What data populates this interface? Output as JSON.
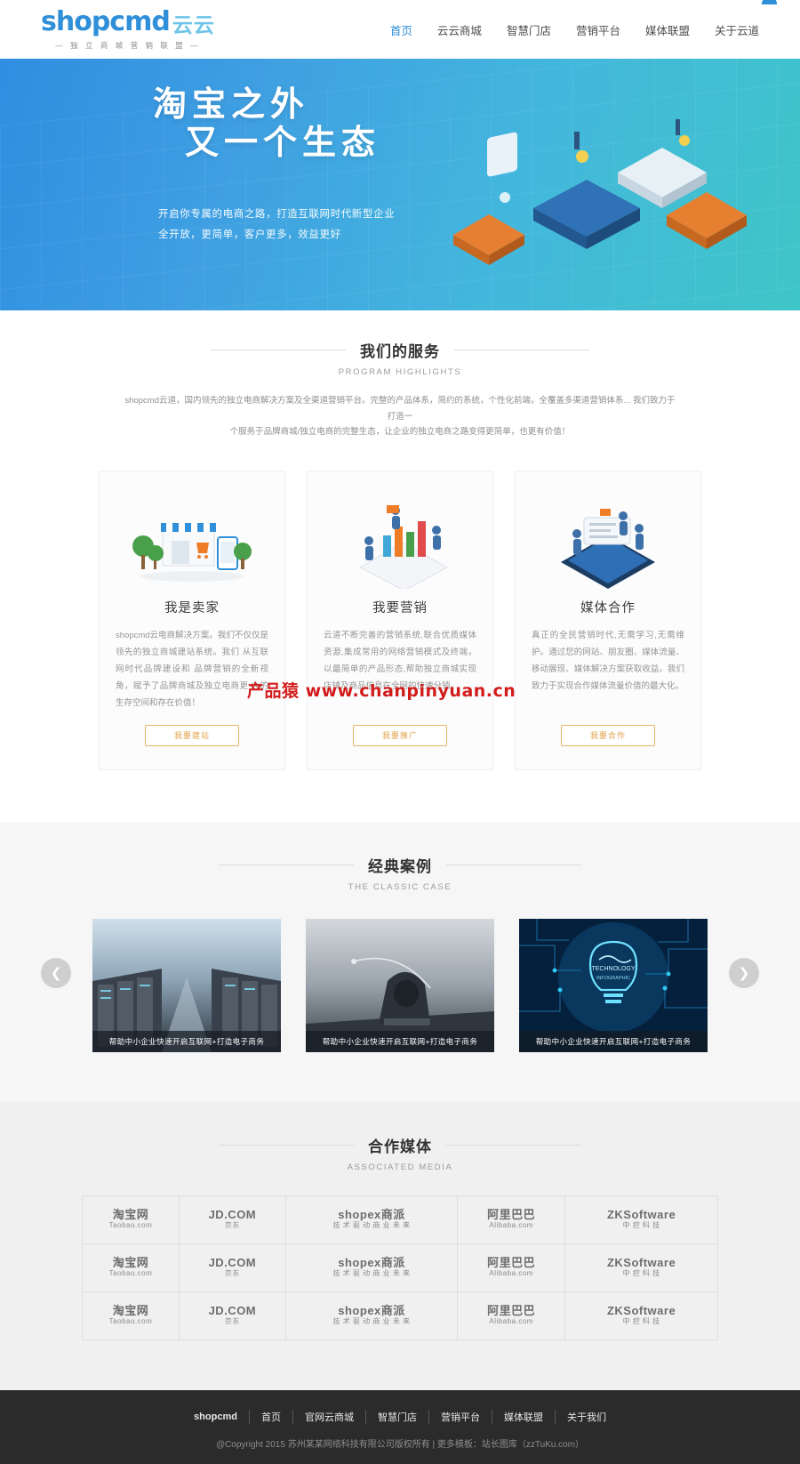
{
  "header": {
    "logo_main": "shopcmd",
    "logo_cn": "云云",
    "logo_tagline": "— 独 立 商 城 营 销 联 盟 —",
    "nav": [
      {
        "label": "首页",
        "active": true
      },
      {
        "label": "云云商城",
        "active": false
      },
      {
        "label": "智慧门店",
        "active": false
      },
      {
        "label": "营销平台",
        "active": false
      },
      {
        "label": "媒体联盟",
        "active": false
      },
      {
        "label": "关于云道",
        "active": false
      }
    ]
  },
  "hero": {
    "title_line1": "淘宝之外",
    "title_line2": "又一个生态",
    "sub_line1": "开启你专属的电商之路，打造互联网时代新型企业",
    "sub_line2": "全开放，更简单，客户更多，效益更好"
  },
  "services": {
    "title": "我们的服务",
    "subtitle": "PROGRAM HIGHLIGHTS",
    "desc_line1": "shopcmd云道，国内领先的独立电商解决方案及全渠道营销平台。完整的产品体系，简约的系统，个性化前端，全覆盖多渠道营销体系... 我们致力于打造一",
    "desc_line2": "个服务于品牌商城/独立电商的完整生态，让企业的独立电商之路变得更简单，也更有价值！",
    "cards": [
      {
        "icon": "storefront-icon",
        "title": "我是卖家",
        "text": "shopcmd云电商解决方案。我们不仅仅是领先的独立商城建站系统。我们 从互联网时代品牌建设和 品牌营销的全新视角，赋予了品牌商城及独立电商更 大的生存空间和存在价值！",
        "button": "我要建站"
      },
      {
        "icon": "bar-chart-icon",
        "title": "我要营销",
        "text": "云道不断完善的营销系统,联合优质媒体资源,集成常用的网络营销模式及终端，以最简单的产品形态,帮助独立商城实现店铺及商品信息在全网的快速分销。",
        "button": "我要推广"
      },
      {
        "icon": "handshake-icon",
        "title": "媒体合作",
        "text": "真正的全民营销时代,无需学习,无需维护。通过您的网站、朋友圈、媒体流量、移动展现、媒体解决方案获取收益。我们致力于实现合作媒体流量价值的最大化。",
        "button": "我要合作"
      }
    ]
  },
  "watermark": "产品猿  www.chanpinyuan.cn",
  "cases": {
    "title": "经典案例",
    "subtitle": "THE CLASSIC CASE",
    "prev_icon": "chevron-left-icon",
    "next_icon": "chevron-right-icon",
    "items": [
      {
        "caption": "帮助中小企业快速开启互联网+打造电子商务"
      },
      {
        "caption": "帮助中小企业快速开启互联网+打造电子商务"
      },
      {
        "caption": "帮助中小企业快速开启互联网+打造电子商务",
        "overlay_top": "TECHNOLOGY",
        "overlay_bottom": "INFOGRAPHIC"
      }
    ]
  },
  "media": {
    "title": "合作媒体",
    "subtitle": "ASSOCIATED MEDIA",
    "brands": [
      {
        "top": "淘宝网",
        "bottom": "Taobao.com",
        "mini": ""
      },
      {
        "top": "JD.COM",
        "bottom": "京东",
        "mini": ""
      },
      {
        "top": "shopex商派",
        "bottom": "技 术 驱 动 商 业 未 来",
        "mini": ""
      },
      {
        "top": "阿里巴巴",
        "bottom": "Alibaba.com",
        "mini": ""
      },
      {
        "top": "ZKSoftware",
        "bottom": "中 控 科 技",
        "mini": ""
      }
    ],
    "rows": 3
  },
  "footer": {
    "links": [
      "shopcmd",
      "首页",
      "官网云商城",
      "智慧门店",
      "营销平台",
      "媒体联盟",
      "关于我们"
    ],
    "copyright": "@Copyright 2015 苏州某某网络科技有限公司版权所有 | 更多模板：",
    "copyright_link": "站长图库（zzTuKu.com）"
  },
  "colors": {
    "brand_blue": "#2f8fd8",
    "accent_orange": "#e0a44c",
    "footer_bg": "#2b2b2b",
    "watermark_red": "#d21c1c"
  }
}
